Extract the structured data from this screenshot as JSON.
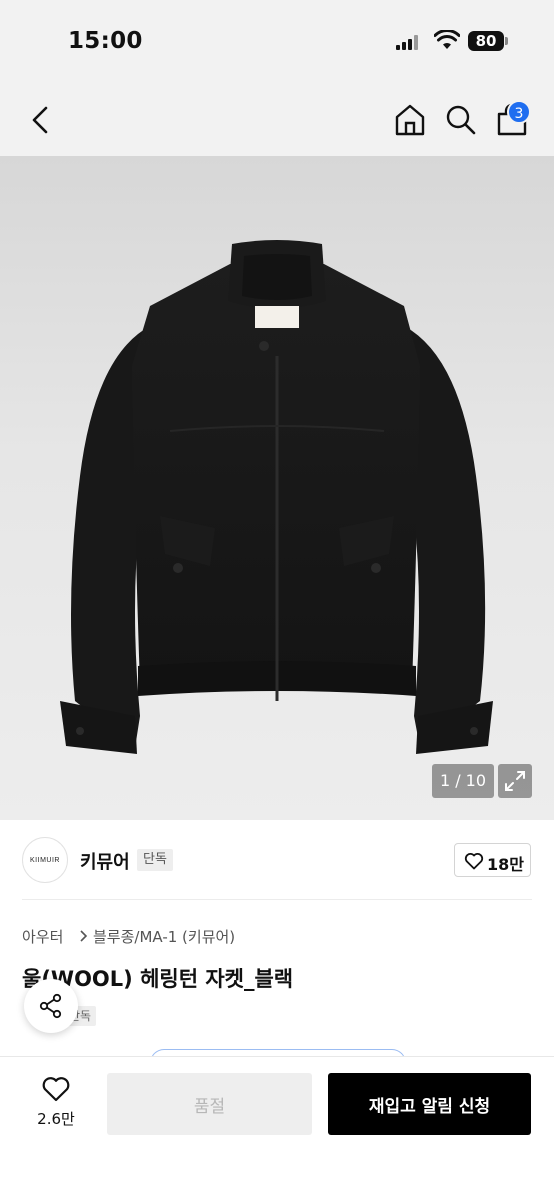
{
  "status_bar": {
    "time": "15:00",
    "battery": "80"
  },
  "header": {
    "back_icon": "chevron-left-icon",
    "home_icon": "home-icon",
    "search_icon": "search-icon",
    "cart_icon": "shopping-bag-icon",
    "cart_count": "3",
    "badge_color": "#1f6ef0"
  },
  "gallery": {
    "pager": "1 / 10",
    "expand_icon": "expand-icon"
  },
  "brand": {
    "logo_text": "KIIMUIR",
    "name": "키뮤어",
    "tag": "단독",
    "like_count": "18만"
  },
  "product": {
    "category_1": "아우터",
    "category_2": "블루종/MA-1 (키뮤어)",
    "title": "울(WOOL) 헤링턴 자켓_블랙",
    "exclusive_tag": "단독"
  },
  "bottom": {
    "wish_count": "2.6만",
    "soldout_label": "품절",
    "restock_label": "재입고 알림 신청"
  }
}
